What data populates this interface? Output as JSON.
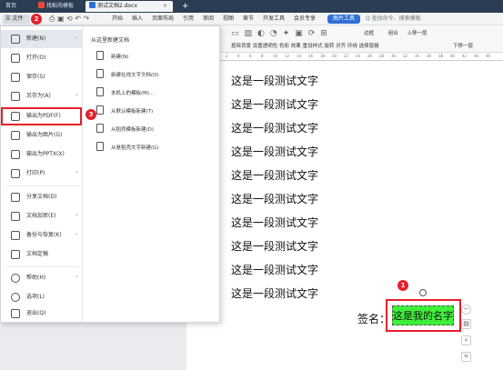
{
  "tabs": [
    {
      "label": "首页"
    },
    {
      "label": "找稻壳模板"
    },
    {
      "label": "测试文档2.docx"
    }
  ],
  "menubar": {
    "file": "文件",
    "items": [
      "开始",
      "插入",
      "页面布局",
      "引用",
      "审阅",
      "视图",
      "章节",
      "开发工具",
      "会员专享"
    ],
    "picture_tools": "图片工具",
    "search": "Q 查找命令、搜索模板"
  },
  "ribbon": {
    "labels": [
      "抠除背景",
      "设置透明色",
      "色彩",
      "效果",
      "重设样式",
      "旋转",
      "对齐",
      "环绕",
      "选择窗格",
      "边框",
      "组合",
      "上移一层",
      "下移一层"
    ]
  },
  "ruler": {
    "ticks": [
      "2",
      "4",
      "6",
      "8",
      "10",
      "12",
      "14",
      "16",
      "18",
      "20",
      "22",
      "24",
      "26",
      "28",
      "30",
      "32",
      "34",
      "36",
      "38",
      "40",
      "42",
      "44",
      "46"
    ]
  },
  "document": {
    "lines": [
      "这是一段测试文字",
      "这是一段测试文字",
      "这是一段测试文字",
      "这是一段测试文字",
      "这是一段测试文字",
      "这是一段测试文字",
      "这是一段测试文字",
      "这是一段测试文字",
      "这是一段测试文字",
      "这是一段测试文字"
    ],
    "signature_label": "签名：",
    "signature_image_text": "这是我的名字"
  },
  "file_menu": {
    "left": [
      {
        "label": "新建(N)",
        "arrow": true
      },
      {
        "label": "打开(O)",
        "arrow": false
      },
      {
        "label": "保存(S)",
        "arrow": false
      },
      {
        "label": "另存为(A)",
        "arrow": true
      },
      {
        "label": "输出为PDF(F)",
        "arrow": false
      },
      {
        "label": "输出为图片(G)",
        "arrow": false
      },
      {
        "label": "输出为PPTX(X)",
        "arrow": false
      },
      {
        "label": "打印(P)",
        "arrow": true
      },
      {
        "label": "分享文档(D)",
        "arrow": false
      },
      {
        "label": "文档加密(E)",
        "arrow": true
      },
      {
        "label": "备份与恢复(K)",
        "arrow": true
      },
      {
        "label": "文档定稿",
        "arrow": false
      },
      {
        "label": "帮助(H)",
        "arrow": true
      },
      {
        "label": "选项(L)",
        "arrow": false
      },
      {
        "label": "退出(Q)",
        "arrow": false
      }
    ],
    "right_heading": "从这里新建文档",
    "right": [
      {
        "label": "新建(N)"
      },
      {
        "label": "新建在线文字文档(O)"
      },
      {
        "label": "本机上的模板(M)..."
      },
      {
        "label": "从默认模板新建(T)"
      },
      {
        "label": "从稻壳模板新建(D)"
      },
      {
        "label": "从是稻壳文字新建(G)"
      }
    ]
  },
  "markers": {
    "m1": "1",
    "m2": "2",
    "m3": "3"
  },
  "colors": {
    "accent_red": "#e5202a",
    "signature_bg": "#3ff03a",
    "picture_tools_bg": "#2f6fd6"
  }
}
